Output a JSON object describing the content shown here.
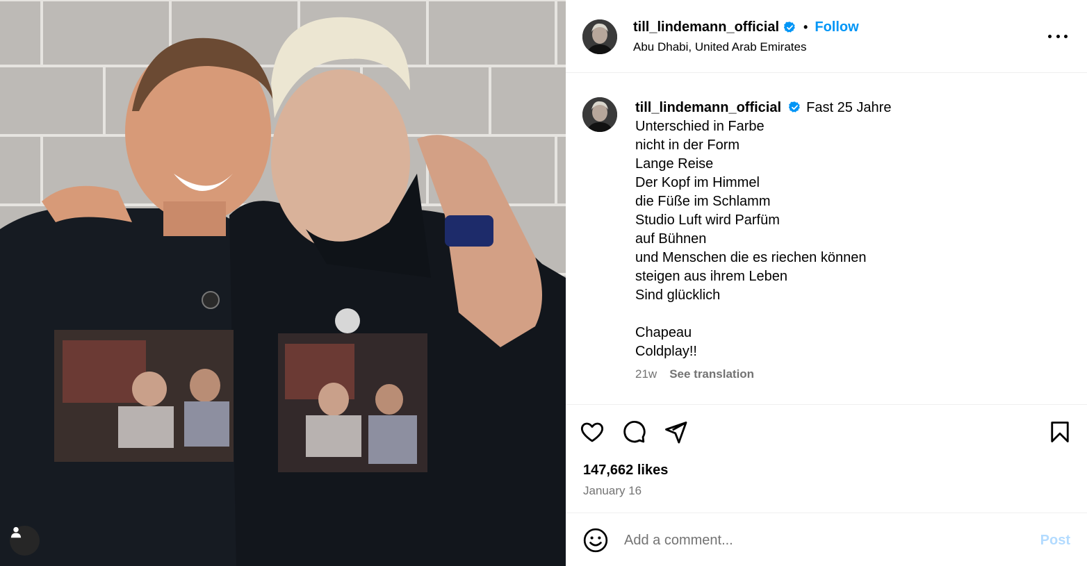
{
  "post": {
    "username": "till_lindemann_official",
    "follow_label": "Follow",
    "separator": "•",
    "location": "Abu Dhabi, United Arab Emirates",
    "caption_first": "Fast 25 Jahre",
    "caption_lines": [
      "Unterschied in Farbe",
      "nicht in der Form",
      "Lange Reise",
      "Der Kopf im Himmel",
      "die Füße im Schlamm",
      "Studio Luft wird Parfüm",
      "auf Bühnen",
      "und Menschen die es riechen können",
      "steigen aus ihrem Leben",
      "Sind glücklich",
      "",
      "Chapeau",
      "Coldplay!!"
    ],
    "age": "21w",
    "see_translation": "See translation",
    "likes": "147,662 likes",
    "date": "January 16"
  },
  "comment": {
    "placeholder": "Add a comment...",
    "post_label": "Post"
  },
  "colors": {
    "accent": "#0095f6",
    "muted": "#737373",
    "post_disabled": "#b3dbff",
    "verified": "#0095f6"
  },
  "icons": [
    "more-options-icon",
    "heart-icon",
    "comment-icon",
    "share-icon",
    "bookmark-icon",
    "emoji-icon",
    "user-tag-icon",
    "verified-badge-icon"
  ]
}
